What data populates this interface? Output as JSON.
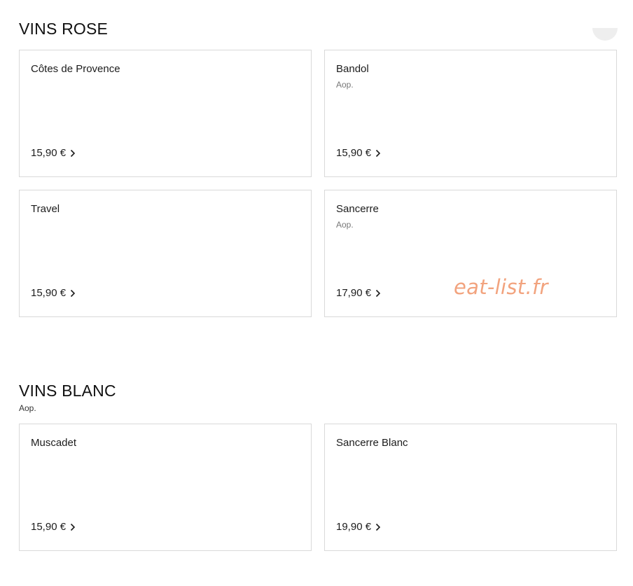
{
  "sections": [
    {
      "title": "VINS ROSE",
      "subtitle": "",
      "items": [
        {
          "name": "Côtes de Provence",
          "sub": "",
          "price": "15,90 €"
        },
        {
          "name": "Bandol",
          "sub": "Aop.",
          "price": "15,90 €"
        },
        {
          "name": "Travel",
          "sub": "",
          "price": "15,90 €"
        },
        {
          "name": "Sancerre",
          "sub": "Aop.",
          "price": "17,90 €"
        }
      ]
    },
    {
      "title": "VINS BLANC",
      "subtitle": "Aop.",
      "items": [
        {
          "name": "Muscadet",
          "sub": "",
          "price": "15,90 €"
        },
        {
          "name": "Sancerre Blanc",
          "sub": "",
          "price": "19,90 €"
        }
      ]
    }
  ],
  "watermark": "eat-list.fr",
  "icons": {
    "price_arrow": "chevron-right-icon"
  },
  "colors": {
    "watermark": "#f2a37e",
    "card_border": "#d9d9d9"
  }
}
